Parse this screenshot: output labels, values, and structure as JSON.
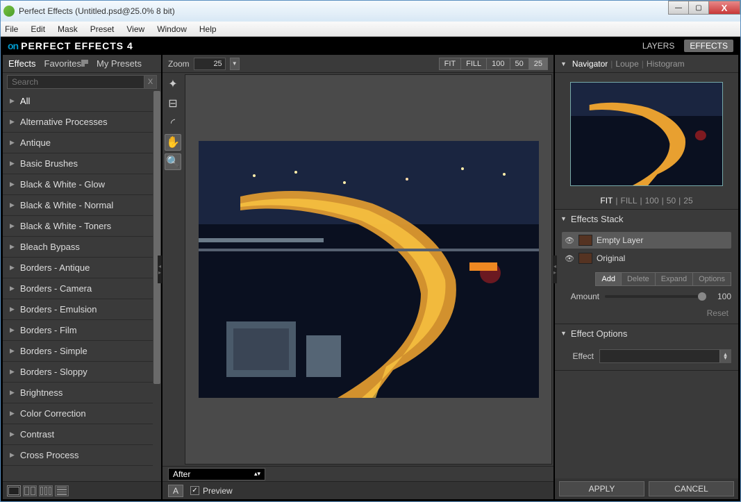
{
  "window": {
    "title": "Perfect Effects (Untitled.psd@25.0% 8 bit)"
  },
  "winbtns": {
    "min": "—",
    "max": "▢",
    "close": "X"
  },
  "menu": [
    "File",
    "Edit",
    "Mask",
    "Preset",
    "View",
    "Window",
    "Help"
  ],
  "brand": {
    "logo": "on",
    "title": "PERFECT EFFECTS 4",
    "tabs": [
      "LAYERS",
      "EFFECTS"
    ],
    "active": "EFFECTS"
  },
  "left": {
    "tabs": [
      "Effects",
      "Favorites",
      "My Presets"
    ],
    "active": "Effects",
    "search_placeholder": "Search",
    "clear": "X",
    "categories": [
      "All",
      "Alternative Processes",
      "Antique",
      "Basic Brushes",
      "Black & White - Glow",
      "Black & White - Normal",
      "Black & White - Toners",
      "Bleach Bypass",
      "Borders - Antique",
      "Borders - Camera",
      "Borders - Emulsion",
      "Borders - Film",
      "Borders - Simple",
      "Borders - Sloppy",
      "Brightness",
      "Color Correction",
      "Contrast",
      "Cross Process"
    ]
  },
  "center": {
    "zoom_label": "Zoom",
    "zoom_value": "25",
    "zbtns": [
      "FIT",
      "FILL",
      "100",
      "50",
      "25"
    ],
    "zactive": "25",
    "viewmode": "After",
    "preview": "Preview"
  },
  "right": {
    "nav_tabs": [
      "Navigator",
      "Loupe",
      "Histogram"
    ],
    "nav_active": "Navigator",
    "nav_zoom": [
      "FIT",
      "FILL",
      "100",
      "50",
      "25"
    ],
    "nav_zactive": "FIT",
    "stack_title": "Effects Stack",
    "layers": [
      {
        "name": "Empty Layer",
        "sel": true
      },
      {
        "name": "Original",
        "sel": false
      }
    ],
    "stack_btns": [
      "Add",
      "Delete",
      "Expand",
      "Options"
    ],
    "stack_active": "Add",
    "amount_label": "Amount",
    "amount_value": "100",
    "reset": "Reset",
    "effopt_title": "Effect Options",
    "effopt_label": "Effect",
    "apply": "APPLY",
    "cancel": "CANCEL"
  }
}
